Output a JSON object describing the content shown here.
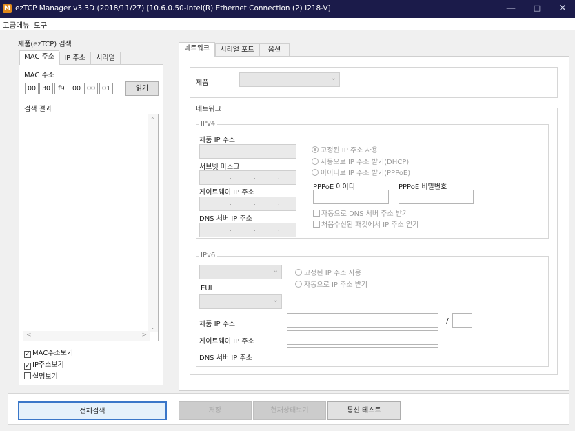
{
  "window": {
    "title": "ezTCP Manager v3.3D (2018/11/27) [10.6.0.50-Intel(R) Ethernet Connection (2) I218-V]",
    "icon": "app-icon"
  },
  "menu": [
    "고급메뉴",
    "도구"
  ],
  "search": {
    "group_title": "제품(ezTCP) 검색",
    "tabs": [
      "MAC 주소",
      "IP 주소",
      "시리얼"
    ],
    "mac_label": "MAC 주소",
    "mac_octets": [
      "00",
      "30",
      "f9",
      "00",
      "00",
      "01"
    ],
    "read_button": "읽기",
    "results_label": "검색 결과",
    "checkboxes": [
      {
        "label": "MAC주소보기",
        "checked": true
      },
      {
        "label": "IP주소보기",
        "checked": true
      },
      {
        "label": "설명보기",
        "checked": false
      }
    ]
  },
  "config": {
    "tabs": [
      "네트워크",
      "시리얼 포트",
      "옵션"
    ],
    "product_label": "제품",
    "network_group": "네트워크",
    "ipv4": {
      "group": "IPv4",
      "ip_label": "제품 IP 주소",
      "subnet_label": "서브넷 마스크",
      "gateway_label": "게이트웨이 IP 주소",
      "dns_label": "DNS 서버 IP 주소",
      "radios": [
        "고정된 IP 주소 사용",
        "자동으로 IP 주소 받기(DHCP)",
        "아이디로 IP 주소 받기(PPPoE)"
      ],
      "pppoe_id_label": "PPPoE 아이디",
      "pppoe_pw_label": "PPPoE 비밀번호",
      "checks": [
        "자동으로 DNS 서버 주소 받기",
        "처음수신된 패킷에서 IP 주소 얻기"
      ]
    },
    "ipv6": {
      "group": "IPv6",
      "radios": [
        "고정된 IP 주소 사용",
        "자동으로 IP 주소 받기"
      ],
      "eui_label": "EUI",
      "ip_label": "제품 IP 주소",
      "prefix_sep": "/",
      "gateway_label": "게이트웨이 IP 주소",
      "dns_label": "DNS 서버 IP 주소"
    }
  },
  "buttons": {
    "search_all": "전체검색",
    "save": "저장",
    "status": "현재상태보기",
    "comm_test": "통신 테스트"
  }
}
